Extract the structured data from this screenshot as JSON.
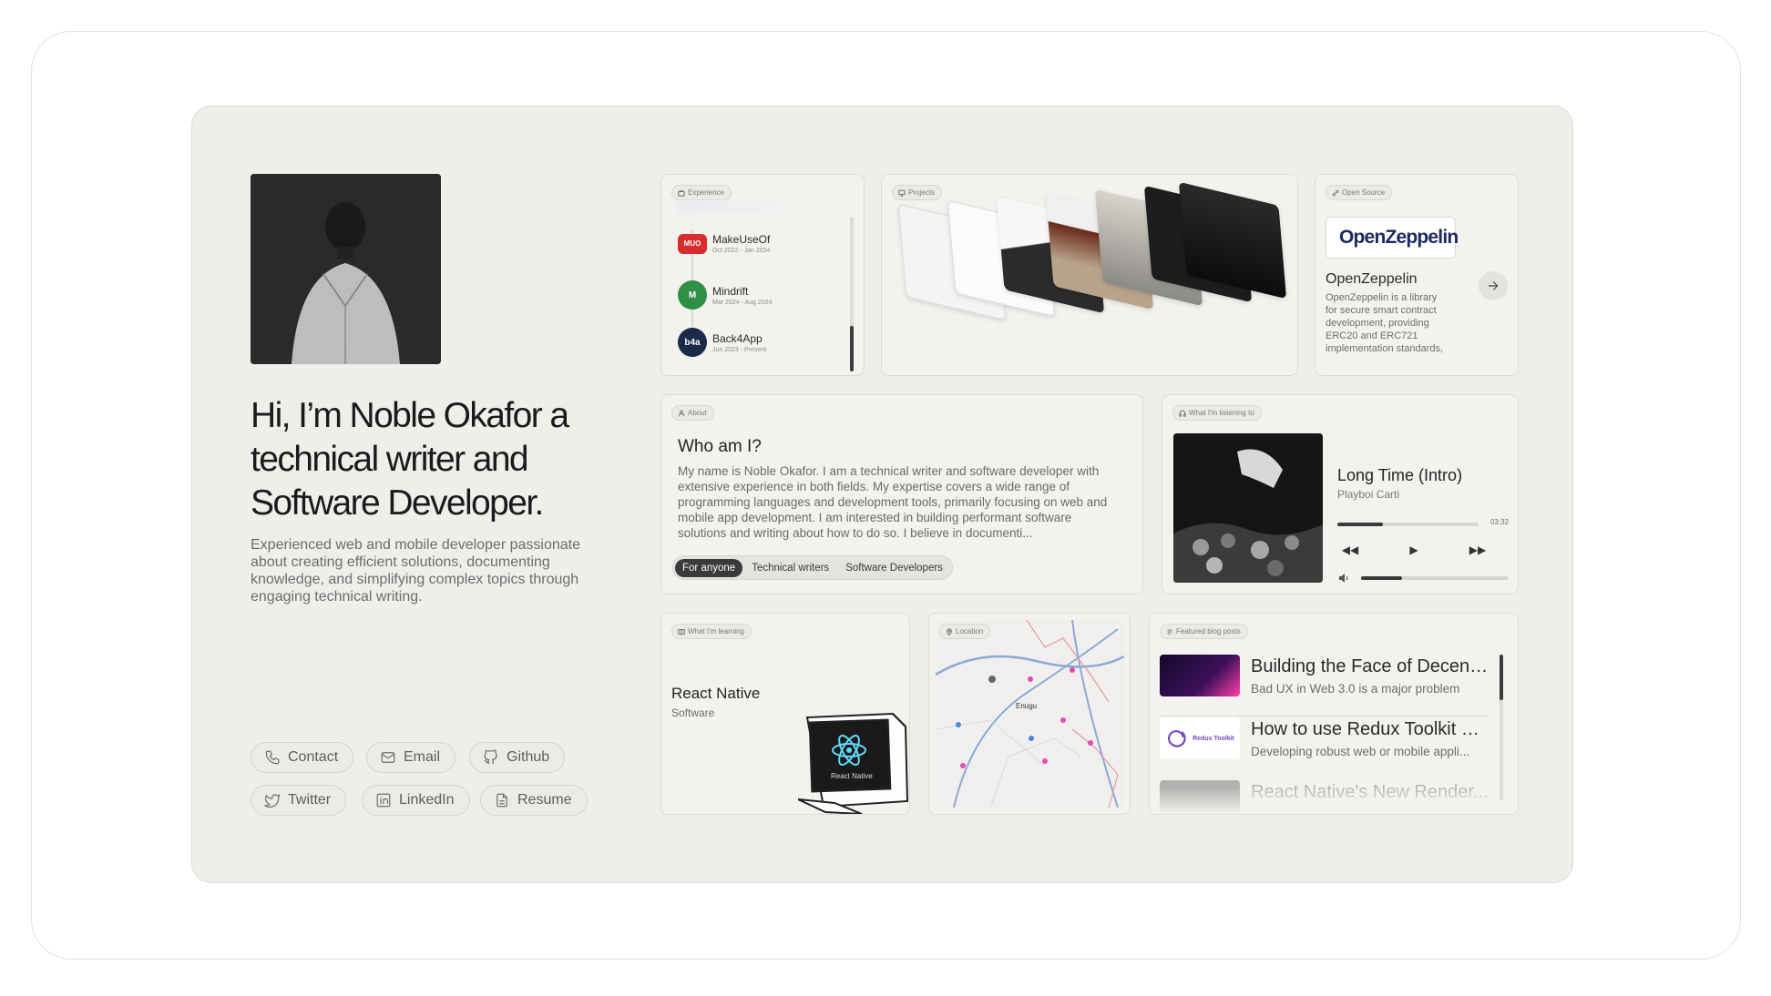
{
  "profile": {
    "headline": "Hi, I’m Noble Okafor a technical writer and Software Developer.",
    "tagline": "Experienced web and mobile developer passionate about creating efficient solutions, documenting knowledge, and simplifying complex topics through engaging technical writing.",
    "links": [
      {
        "label": "Contact",
        "icon": "phone-icon"
      },
      {
        "label": "Email",
        "icon": "mail-icon"
      },
      {
        "label": "Github",
        "icon": "github-icon"
      },
      {
        "label": "Twitter",
        "icon": "twitter-icon"
      },
      {
        "label": "LinkedIn",
        "icon": "linkedin-icon"
      },
      {
        "label": "Resume",
        "icon": "document-icon"
      }
    ]
  },
  "experience": {
    "chip": "Experience",
    "items": [
      {
        "company": "MakeUseOf",
        "dates": "Oct 2022 - Jan 2024",
        "logo_text": "MUO",
        "color": "#d92c2c"
      },
      {
        "company": "Mindrift",
        "dates": "Mar 2024 - Aug 2024",
        "logo_text": "M",
        "color": "#1f7a3a"
      },
      {
        "company": "Back4App",
        "dates": "Jun 2023 - Present",
        "logo_text": "b4a",
        "color": "#1c2a4a"
      }
    ]
  },
  "projects": {
    "chip": "Projects"
  },
  "open_source": {
    "chip": "Open Source",
    "logo_text": "OpenZeppelin",
    "title": "OpenZeppelin",
    "description": "OpenZeppelin is a library for secure smart contract development, providing ERC20 and ERC721 implementation standards, for building decentr..."
  },
  "about": {
    "chip": "About",
    "title": "Who am I?",
    "text": "My name is Noble Okafor. I am a technical writer and software developer with extensive experience in both fields. My expertise covers a wide range of programming languages and development tools, primarily focusing on web and mobile app development. I am interested in building performant software solutions and writing about how to do so. I believe in documenti...",
    "audience_tabs": [
      "For anyone",
      "Technical writers",
      "Software Developers"
    ],
    "active_tab": "For anyone"
  },
  "music": {
    "chip": "What I'm listening to",
    "track": "Long Time (Intro)",
    "artist": "Playboi Carti",
    "duration": "03:32",
    "progress": 0.32,
    "volume": 0.28
  },
  "learning": {
    "chip": "What I'm learning",
    "title": "React Native",
    "subtitle": "Software",
    "screen_label": "React Native"
  },
  "location": {
    "chip": "Location",
    "city": "Enugu"
  },
  "blog": {
    "chip": "Featured blog posts",
    "posts": [
      {
        "title": "Building the Face of Decent...",
        "subtitle": "Bad UX in Web 3.0 is a major problem"
      },
      {
        "title": "How to use Redux Toolkit wi...",
        "subtitle": "Developing robust web or mobile appli..."
      },
      {
        "title": "React Native's New Render...",
        "subtitle": ""
      }
    ],
    "thumb2_label": "Redux Toolkit"
  }
}
